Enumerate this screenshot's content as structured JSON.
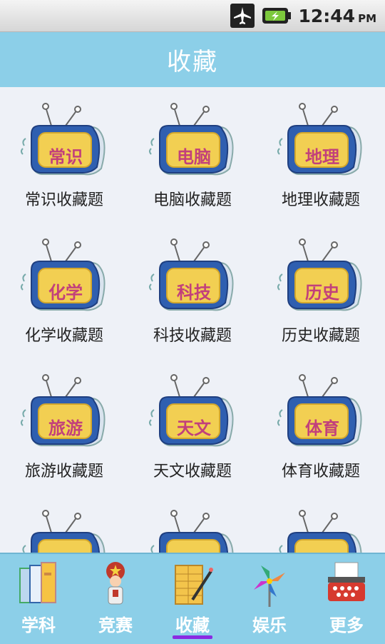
{
  "status": {
    "time": "12:44",
    "ampm": "PM"
  },
  "header": {
    "title": "收藏"
  },
  "grid": [
    {
      "tv_label": "常识",
      "caption": "常识收藏题"
    },
    {
      "tv_label": "电脑",
      "caption": "电脑收藏题"
    },
    {
      "tv_label": "地理",
      "caption": "地理收藏题"
    },
    {
      "tv_label": "化学",
      "caption": "化学收藏题"
    },
    {
      "tv_label": "科技",
      "caption": "科技收藏题"
    },
    {
      "tv_label": "历史",
      "caption": "历史收藏题"
    },
    {
      "tv_label": "旅游",
      "caption": "旅游收藏题"
    },
    {
      "tv_label": "天文",
      "caption": "天文收藏题"
    },
    {
      "tv_label": "体育",
      "caption": "体育收藏题"
    }
  ],
  "nav": [
    {
      "label": "学科",
      "icon": "books-icon"
    },
    {
      "label": "竞赛",
      "icon": "contestant-icon"
    },
    {
      "label": "收藏",
      "icon": "notepad-icon",
      "selected": true
    },
    {
      "label": "娱乐",
      "icon": "pinwheel-icon"
    },
    {
      "label": "更多",
      "icon": "typewriter-icon"
    }
  ],
  "colors": {
    "header_bg": "#8ccfe8",
    "tv_blue": "#2f5fb0",
    "tv_screen": "#f2cf52",
    "label_pink": "#c2407b",
    "nav_selected": "#8a2be2"
  }
}
